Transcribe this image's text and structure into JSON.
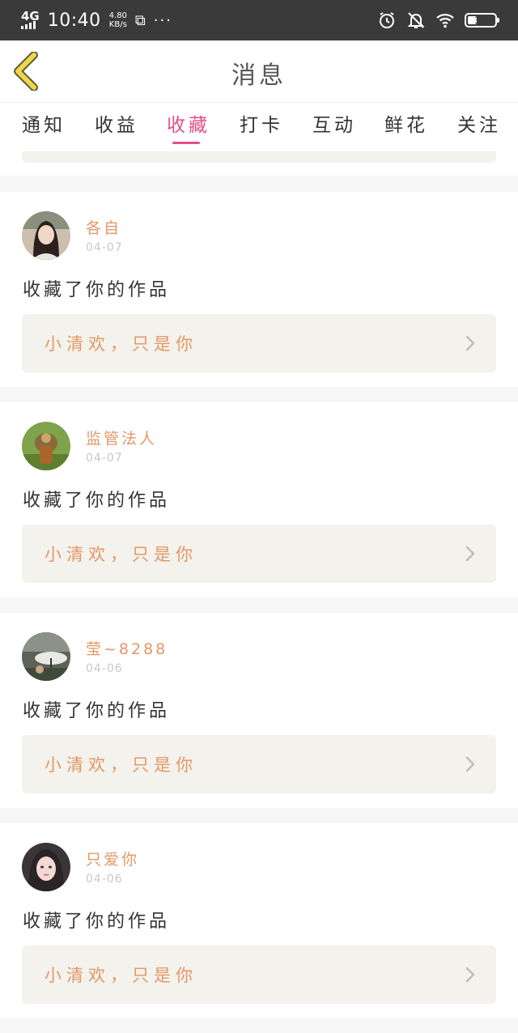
{
  "status_bar": {
    "network": "4G",
    "time": "10:40",
    "speed_value": "4.80",
    "speed_unit": "KB/s",
    "battery": "31"
  },
  "header": {
    "title": "消息"
  },
  "tabs": [
    {
      "label": "通知",
      "active": false
    },
    {
      "label": "收益",
      "active": false
    },
    {
      "label": "收藏",
      "active": true
    },
    {
      "label": "打卡",
      "active": false
    },
    {
      "label": "互动",
      "active": false
    },
    {
      "label": "鲜花",
      "active": false
    },
    {
      "label": "关注",
      "active": false
    }
  ],
  "notifications": [
    {
      "user": "各自",
      "date": "04-07",
      "text": "收藏了你的作品",
      "work_title": "小清欢，只是你"
    },
    {
      "user": "监管法人",
      "date": "04-07",
      "text": "收藏了你的作品",
      "work_title": "小清欢，只是你"
    },
    {
      "user": "莹~8288",
      "date": "04-06",
      "text": "收藏了你的作品",
      "work_title": "小清欢，只是你"
    },
    {
      "user": "只爱你",
      "date": "04-06",
      "text": "收藏了你的作品",
      "work_title": "小清欢，只是你"
    }
  ],
  "colors": {
    "accent": "#e34f8a",
    "name_orange": "#e49867",
    "back_icon": "#f0d64a"
  }
}
